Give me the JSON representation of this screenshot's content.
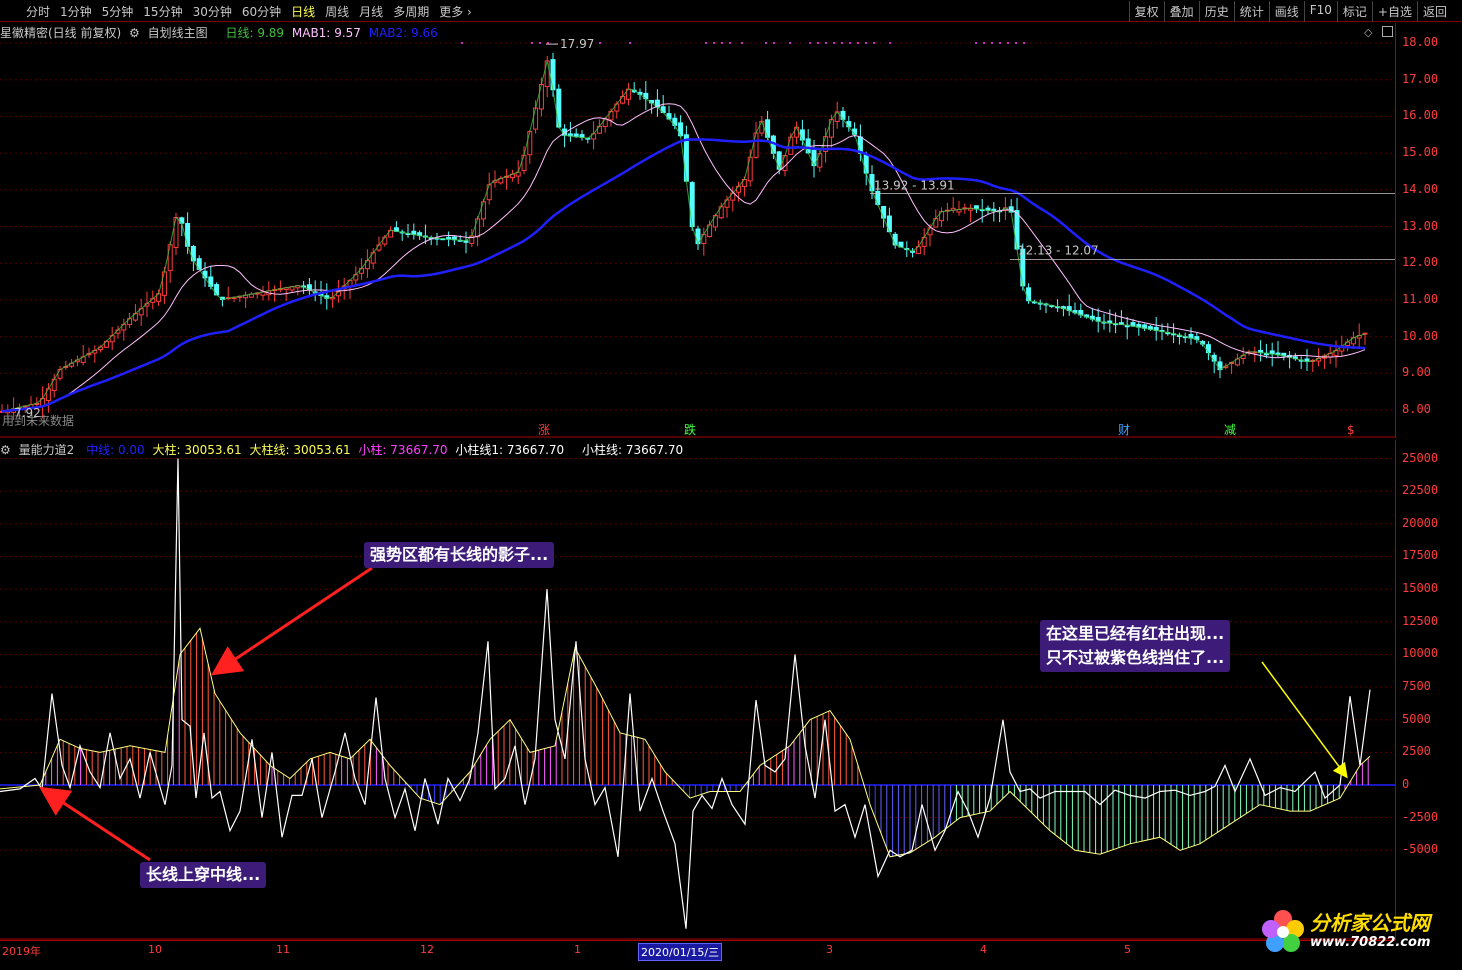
{
  "toolbar": {
    "periods": [
      "分时",
      "1分钟",
      "5分钟",
      "15分钟",
      "30分钟",
      "60分钟",
      "日线",
      "周线",
      "月线",
      "多周期",
      "更多"
    ],
    "active_period": "日线",
    "tools": [
      "复权",
      "叠加",
      "历史",
      "统计",
      "画线",
      "F10",
      "标记",
      "+自选",
      "返回"
    ]
  },
  "main_header": {
    "stock_name": "星徽精密(日线 前复权)",
    "indicator": "自划线主图",
    "day_label": "日线:",
    "day_value": "9.89",
    "mab1_label": "MAB1:",
    "mab1_value": "9.57",
    "mab2_label": "MAB2:",
    "mab2_value": "9.66",
    "no_future": "用到未来数据"
  },
  "main_annotations": {
    "high": "17.97",
    "low": "7.92",
    "line1": "13.92 - 13.91",
    "line2": "12.13 - 12.07",
    "markers": [
      {
        "text": "涨",
        "color": "#ff3c3c"
      },
      {
        "text": "跌",
        "color": "#40ff40"
      },
      {
        "text": "财",
        "color": "#40a0ff"
      },
      {
        "text": "减",
        "color": "#40ff40"
      },
      {
        "text": "$",
        "color": "#ff3c3c"
      }
    ]
  },
  "main_axis": [
    "18.00",
    "17.00",
    "16.00",
    "15.00",
    "14.00",
    "13.00",
    "12.00",
    "11.00",
    "10.00",
    "9.00",
    "8.00"
  ],
  "sub_header": {
    "name": "量能力道2",
    "mid_label": "中线:",
    "mid_value": "0.00",
    "big_label": "大柱:",
    "big_value": "30053.61",
    "bigline_label": "大柱线:",
    "bigline_value": "30053.61",
    "small_label": "小柱:",
    "small_value": "73667.70",
    "smallline1_label": "小柱线1:",
    "smallline1_value": "73667.70",
    "smallline_label": "小柱线:",
    "smallline_value": "73667.70"
  },
  "sub_axis": [
    "25000",
    "22500",
    "20000",
    "17500",
    "15000",
    "12500",
    "10000",
    "7500",
    "5000",
    "2500",
    "0",
    "-2500",
    "-5000"
  ],
  "date_axis": {
    "labels": [
      "2019年",
      "10",
      "11",
      "12",
      "1",
      "3",
      "4",
      "5"
    ],
    "cursor": "2020/01/15/三"
  },
  "annotations": {
    "strong": "强势区都有长线的影子...",
    "cross": "长线上穿中线...",
    "red1": "在这里已经有红柱出现...",
    "red2": "只不过被紫色线挡住了..."
  },
  "logo": {
    "name": "分析家公式网",
    "url": "www.70822.com"
  },
  "colors": {
    "up": "#ff3c3c",
    "down": "#54ffff",
    "ma1": "#ffc0ff",
    "ma2": "#2020ff",
    "day_line": "#40c040"
  }
}
